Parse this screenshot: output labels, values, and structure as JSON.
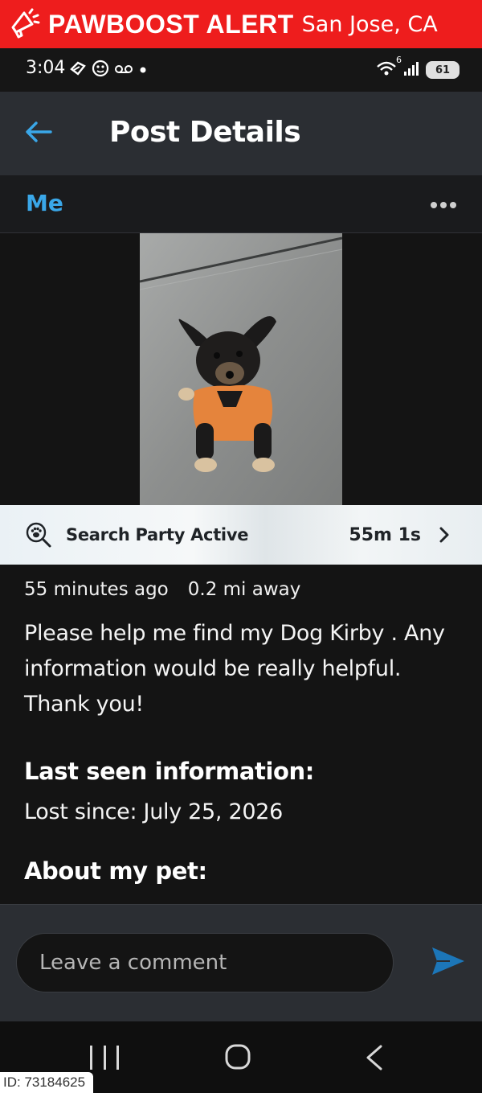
{
  "alert": {
    "title": "PAWBOOST ALERT",
    "location": "San Jose, CA",
    "icon": "megaphone-icon",
    "color": "#ee1d1d"
  },
  "status_bar": {
    "time": "3:04",
    "left_icons": [
      "notification-icon",
      "app-icon",
      "voicemail-icon",
      "dot-icon"
    ],
    "right_icons": [
      "wifi-icon",
      "signal-icon",
      "battery-icon"
    ],
    "wifi_label": "6",
    "battery_label": "61"
  },
  "header": {
    "title": "Post Details",
    "back_icon": "back-arrow-icon"
  },
  "author": {
    "name": "Me",
    "accent": "#3aa7e8"
  },
  "search_party": {
    "label": "Search Party Active",
    "timer": "55m 1s",
    "icon": "paw-search-icon"
  },
  "post": {
    "time_ago": "55 minutes ago",
    "distance": "0.2 mi away",
    "body": "Please help me find my Dog Kirby . Any information would be really helpful. Thank you!",
    "last_seen_title": "Last seen information:",
    "lost_since": "Lost since: July 25, 2026",
    "about_title": "About my pet:"
  },
  "comment": {
    "placeholder": "Leave a comment",
    "send_icon": "send-icon"
  },
  "nav": {
    "icons": [
      "recents-icon",
      "home-icon",
      "back-icon"
    ]
  },
  "id_tag": "ID: 73184625"
}
